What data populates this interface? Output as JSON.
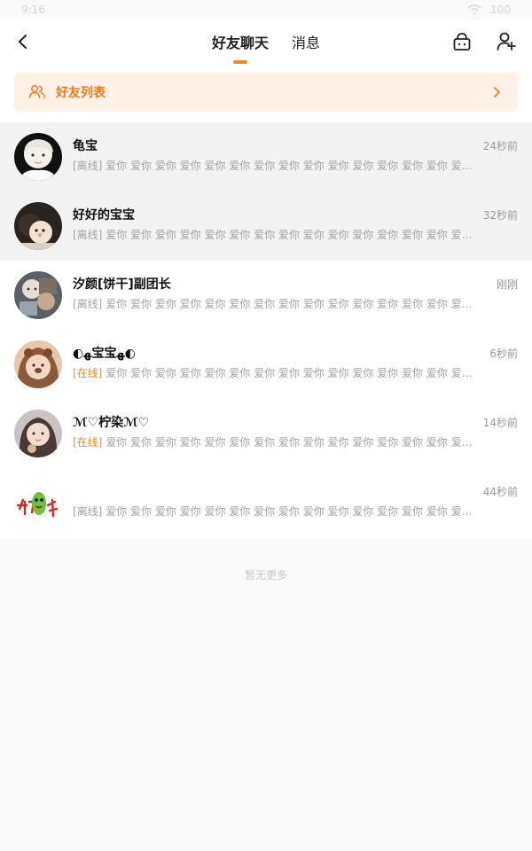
{
  "statusbar": {
    "time": "9:16",
    "battery": "100"
  },
  "header": {
    "tabs": [
      {
        "label": "好友聊天",
        "active": true
      },
      {
        "label": "消息",
        "active": false
      }
    ],
    "accent_color": "#f08a22"
  },
  "banner": {
    "label": "好友列表"
  },
  "chats": [
    {
      "name": "龟宝",
      "time": "24秒前",
      "status": "[离线]",
      "message": "爱你 爱你 爱你 爱你 爱你 爱你 爱你 爱你 爱你 爱你 爱你 爱你 爱你 爱你 爱你 爱你 爱..."
    },
    {
      "name": "好好的宝宝",
      "time": "32秒前",
      "status": "[离线]",
      "message": "爱你 爱你 爱你 爱你 爱你 爱你 爱你 爱你 爱你 爱你 爱你 爱你 爱你 爱你 爱你 爱你 爱..."
    },
    {
      "name": "汐颜[饼干]副团长",
      "time": "刚刚",
      "status": "[离线]",
      "message": "爱你 爱你 爱你 爱你 爱你 爱你 爱你 爱你 爱你 爱你 爱你 爱你 爱你 爱你 爱你 爱你 ..."
    },
    {
      "name": "◐ﻬ宝宝ﻬ◐",
      "time": "6秒前",
      "status": "[在线]",
      "message": "爱你 爱你 爱你 爱你 爱你 爱你 爱你 爱你 爱你 爱你 爱你 爱你 爱你 爱你 爱你 爱你..."
    },
    {
      "name": "ℳ♡柠染ℳ♡",
      "time": "14秒前",
      "status": "[在线]",
      "message": "爱你 爱你 爱你 爱你 爱你 爱你 爱你 爱你 爱你 爱你 爱你 爱你 爱你 爱你 爱你 爱..."
    },
    {
      "name": "",
      "time": "44秒前",
      "status": "[离线]",
      "message": "爱你 爱你 爱你 爱你 爱你 爱你 爱你 爱你 爱你 爱你 爱你 爱你 爱你 爱你 爱你 爱你 爱..."
    }
  ],
  "footer": {
    "no_more": "暂无更多"
  }
}
